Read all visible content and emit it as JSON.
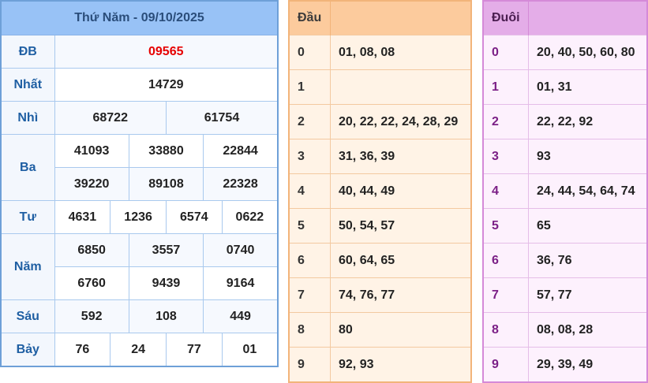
{
  "results": {
    "title": "Thứ Năm - 09/10/2025",
    "prizes": [
      {
        "label": "ĐB",
        "values": [
          "09565"
        ]
      },
      {
        "label": "Nhất",
        "values": [
          "14729"
        ]
      },
      {
        "label": "Nhì",
        "values": [
          "68722",
          "61754"
        ]
      },
      {
        "label": "Ba",
        "values": [
          "41093",
          "33880",
          "22844",
          "39220",
          "89108",
          "22328"
        ]
      },
      {
        "label": "Tư",
        "values": [
          "4631",
          "1236",
          "6574",
          "0622"
        ]
      },
      {
        "label": "Năm",
        "values": [
          "6850",
          "3557",
          "0740",
          "6760",
          "9439",
          "9164"
        ]
      },
      {
        "label": "Sáu",
        "values": [
          "592",
          "108",
          "449"
        ]
      },
      {
        "label": "Bảy",
        "values": [
          "76",
          "24",
          "77",
          "01"
        ]
      }
    ]
  },
  "dau": {
    "header": "Đầu",
    "rows": [
      {
        "digit": "0",
        "values": "01, 08, 08"
      },
      {
        "digit": "1",
        "values": ""
      },
      {
        "digit": "2",
        "values": "20, 22, 22, 24, 28, 29"
      },
      {
        "digit": "3",
        "values": "31, 36, 39"
      },
      {
        "digit": "4",
        "values": "40, 44, 49"
      },
      {
        "digit": "5",
        "values": "50, 54, 57"
      },
      {
        "digit": "6",
        "values": "60, 64, 65"
      },
      {
        "digit": "7",
        "values": "74, 76, 77"
      },
      {
        "digit": "8",
        "values": "80"
      },
      {
        "digit": "9",
        "values": "92, 93"
      }
    ]
  },
  "duoi": {
    "header": "Đuôi",
    "rows": [
      {
        "digit": "0",
        "values": "20, 40, 50, 60, 80"
      },
      {
        "digit": "1",
        "values": "01, 31"
      },
      {
        "digit": "2",
        "values": "22, 22, 92"
      },
      {
        "digit": "3",
        "values": "93"
      },
      {
        "digit": "4",
        "values": "24, 44, 54, 64, 74"
      },
      {
        "digit": "5",
        "values": "65"
      },
      {
        "digit": "6",
        "values": "36, 76"
      },
      {
        "digit": "7",
        "values": "57, 77"
      },
      {
        "digit": "8",
        "values": "08, 08, 28"
      },
      {
        "digit": "9",
        "values": "29, 39, 49"
      }
    ]
  },
  "colors": {
    "special_prize": "#e60000",
    "results_header": "#98c2f6",
    "dau_header": "#fccb9d",
    "duoi_header": "#e4ade8"
  }
}
